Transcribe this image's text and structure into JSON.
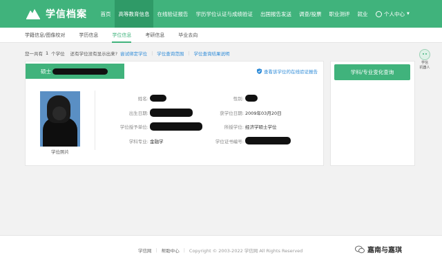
{
  "topnav": {
    "logo_text": "学信档案",
    "items": [
      {
        "label": "首页",
        "active": false
      },
      {
        "label": "高等教育信息",
        "active": true
      },
      {
        "label": "在线验证报告",
        "active": false
      },
      {
        "label": "学历学位认证与成绩验证",
        "active": false
      },
      {
        "label": "出国报告发送",
        "active": false
      },
      {
        "label": "调查/投票",
        "active": false
      },
      {
        "label": "职业测评",
        "active": false
      },
      {
        "label": "就业",
        "active": false
      }
    ],
    "user_center": "个人中心",
    "accent_color": "#40b37c"
  },
  "subnav": {
    "items": [
      {
        "label": "学籍信息/图像校对",
        "active": false
      },
      {
        "label": "学历信息",
        "active": false
      },
      {
        "label": "学位信息",
        "active": true
      },
      {
        "label": "考研信息",
        "active": false
      },
      {
        "label": "毕业去向",
        "active": false
      }
    ]
  },
  "infobar": {
    "prefix": "您一共有",
    "count": "1",
    "suffix": "个学位",
    "question": "还有学位没有显示出来?",
    "link1": "尝试绑定学位",
    "link2": "学位查询范围",
    "link3": "学位查询结果说明"
  },
  "degree_card": {
    "tag_prefix": "硕士",
    "verify_link": "查看该学位的在线验证报告",
    "photo_caption": "学位照片",
    "fields": {
      "name_label": "姓名:",
      "gender_label": "性别:",
      "birth_label": "出生日期:",
      "award_date_label": "获学位日期:",
      "award_date_value": "2009年03月20日",
      "school_label": "学位授予单位:",
      "degree_label": "所授学位:",
      "degree_value": "经济学硕士学位",
      "major_label": "学科专业:",
      "major_value": "金融学",
      "cert_label": "学位证书编号:"
    }
  },
  "side": {
    "button_label": "学科/专业变化查询"
  },
  "robot": {
    "line1": "学信",
    "line2": "机器人"
  },
  "footer": {
    "link1": "学信网",
    "link2": "帮助中心",
    "copyright": "Copyright © 2003-2022 学信网 All Rights Reserved"
  },
  "watermark": {
    "text": "嘉南与嘉琪"
  }
}
